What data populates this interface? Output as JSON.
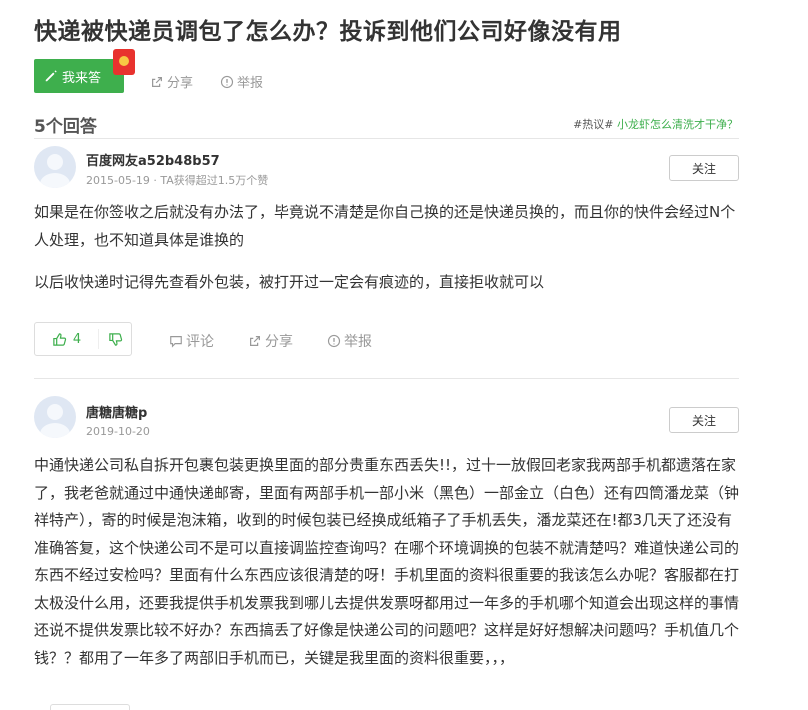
{
  "question": {
    "title": "快递被快递员调包了怎么办？投诉到他们公司好像没有用",
    "answer_button": "我来答",
    "share": "分享",
    "report": "举报"
  },
  "answers_header": {
    "count": "5个回答",
    "hot_tag": "#热议#",
    "hot_link": "小龙虾怎么清洗才干净？"
  },
  "answers": [
    {
      "user": "百度网友a52b48b57",
      "meta": "2015-05-19 · TA获得超过1.5万个赞",
      "follow": "关注",
      "paragraphs": [
        "如果是在你签收之后就没有办法了，毕竟说不清楚是你自己换的还是快递员换的，而且你的快件会经过N个人处理，也不知道具体是谁换的",
        "以后收快递时记得先查看外包装，被打开过一定会有痕迹的，直接拒收就可以"
      ],
      "likes": "4",
      "comment": "评论",
      "share": "分享",
      "report": "举报"
    },
    {
      "user": "唐糖唐糖p",
      "meta": "2019-10-20",
      "follow": "关注",
      "paragraphs": [
        "中通快递公司私自拆开包裹包装更换里面的部分贵重东西丢失!!，过十一放假回老家我两部手机都遗落在家了，我老爸就通过中通快递邮寄，里面有两部手机一部小米（黑色）一部金立（白色）还有四筒潘龙菜（钟祥特产），寄的时候是泡沫箱，收到的时候包装已经换成纸箱子了手机丢失，潘龙菜还在!都3几天了还没有准确答复，这个快递公司不是可以直接调监控查询吗？在哪个环境调换的包装不就清楚吗？难道快递公司的东西不经过安检吗？里面有什么东西应该很清楚的呀！手机里面的资料很重要的我该怎么办呢？客服都在打太极没什么用，还要我提供手机发票我到哪儿去提供发票呀都用过一年多的手机哪个知道会出现这样的事情还说不提供发票比较不好办？东西搞丢了好像是快递公司的问题吧？这样是好好想解决问题吗？手机值几个钱？？都用了一年多了两部旧手机而已，关键是我里面的资料很重要，，，"
      ]
    }
  ]
}
